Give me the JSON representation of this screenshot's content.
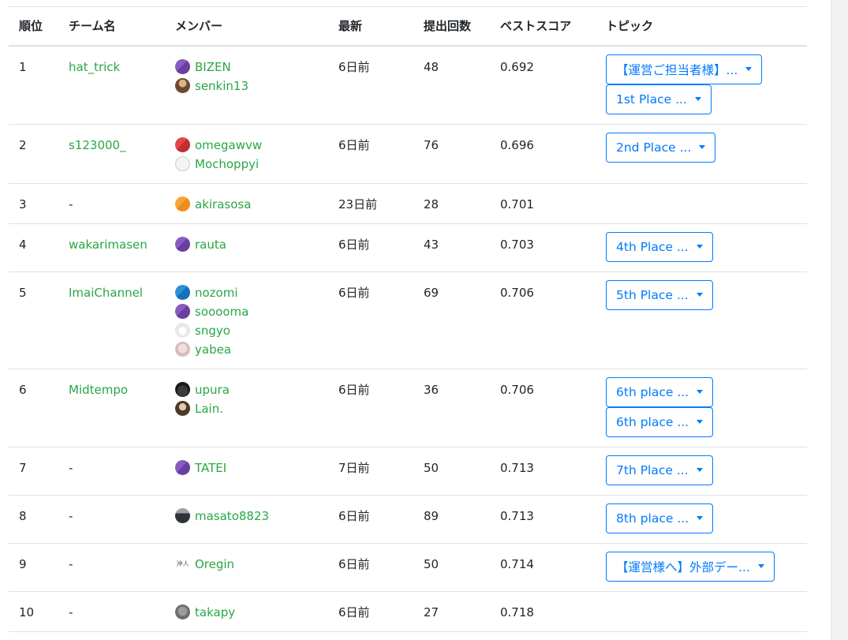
{
  "headers": {
    "rank": "順位",
    "team": "チーム名",
    "members": "メンバー",
    "latest": "最新",
    "submissions": "提出回数",
    "best_score": "ベストスコア",
    "topics": "トピック"
  },
  "rows": [
    {
      "rank": "1",
      "team": "hat_trick",
      "team_is_link": true,
      "members": [
        {
          "name": "BIZEN",
          "avatar": "av-purple"
        },
        {
          "name": "senkin13",
          "avatar": "av-photo1"
        }
      ],
      "latest": "6日前",
      "submissions": "48",
      "score": "0.692",
      "topics": [
        "【運営ご担当者様】...",
        "1st Place ..."
      ]
    },
    {
      "rank": "2",
      "team": "s123000_",
      "team_is_link": true,
      "members": [
        {
          "name": "omegawvw",
          "avatar": "av-red"
        },
        {
          "name": "Mochoppyi",
          "avatar": "av-white"
        }
      ],
      "latest": "6日前",
      "submissions": "76",
      "score": "0.696",
      "topics": [
        "2nd Place ..."
      ]
    },
    {
      "rank": "3",
      "team": "-",
      "team_is_link": false,
      "members": [
        {
          "name": "akirasosa",
          "avatar": "av-orange"
        }
      ],
      "latest": "23日前",
      "submissions": "28",
      "score": "0.701",
      "topics": []
    },
    {
      "rank": "4",
      "team": "wakarimasen",
      "team_is_link": true,
      "members": [
        {
          "name": "rauta",
          "avatar": "av-purple"
        }
      ],
      "latest": "6日前",
      "submissions": "43",
      "score": "0.703",
      "topics": [
        "4th Place ..."
      ]
    },
    {
      "rank": "5",
      "team": "ImaiChannel",
      "team_is_link": true,
      "members": [
        {
          "name": "nozomi",
          "avatar": "av-blue"
        },
        {
          "name": "sooooma",
          "avatar": "av-purple"
        },
        {
          "name": "sngyo",
          "avatar": "av-cat"
        },
        {
          "name": "yabea",
          "avatar": "av-pink"
        }
      ],
      "latest": "6日前",
      "submissions": "69",
      "score": "0.706",
      "topics": [
        "5th Place ..."
      ]
    },
    {
      "rank": "6",
      "team": "Midtempo",
      "team_is_link": true,
      "members": [
        {
          "name": "upura",
          "avatar": "av-dark"
        },
        {
          "name": "Lain.",
          "avatar": "av-person"
        }
      ],
      "latest": "6日前",
      "submissions": "36",
      "score": "0.706",
      "topics": [
        "6th place ...",
        "6th place ..."
      ]
    },
    {
      "rank": "7",
      "team": "-",
      "team_is_link": false,
      "members": [
        {
          "name": "TATEI",
          "avatar": "av-purple"
        }
      ],
      "latest": "7日前",
      "submissions": "50",
      "score": "0.713",
      "topics": [
        "7th Place ..."
      ]
    },
    {
      "rank": "8",
      "team": "-",
      "team_is_link": false,
      "members": [
        {
          "name": "masato8823",
          "avatar": "av-car"
        }
      ],
      "latest": "6日前",
      "submissions": "89",
      "score": "0.713",
      "topics": [
        "8th place ..."
      ]
    },
    {
      "rank": "9",
      "team": "-",
      "team_is_link": false,
      "members": [
        {
          "name": "Oregin",
          "avatar": "av-text"
        }
      ],
      "latest": "6日前",
      "submissions": "50",
      "score": "0.714",
      "topics": [
        "【運営様へ】外部デー..."
      ]
    },
    {
      "rank": "10",
      "team": "-",
      "team_is_link": false,
      "members": [
        {
          "name": "takapy",
          "avatar": "av-gray"
        }
      ],
      "latest": "6日前",
      "submissions": "27",
      "score": "0.718",
      "topics": []
    }
  ]
}
